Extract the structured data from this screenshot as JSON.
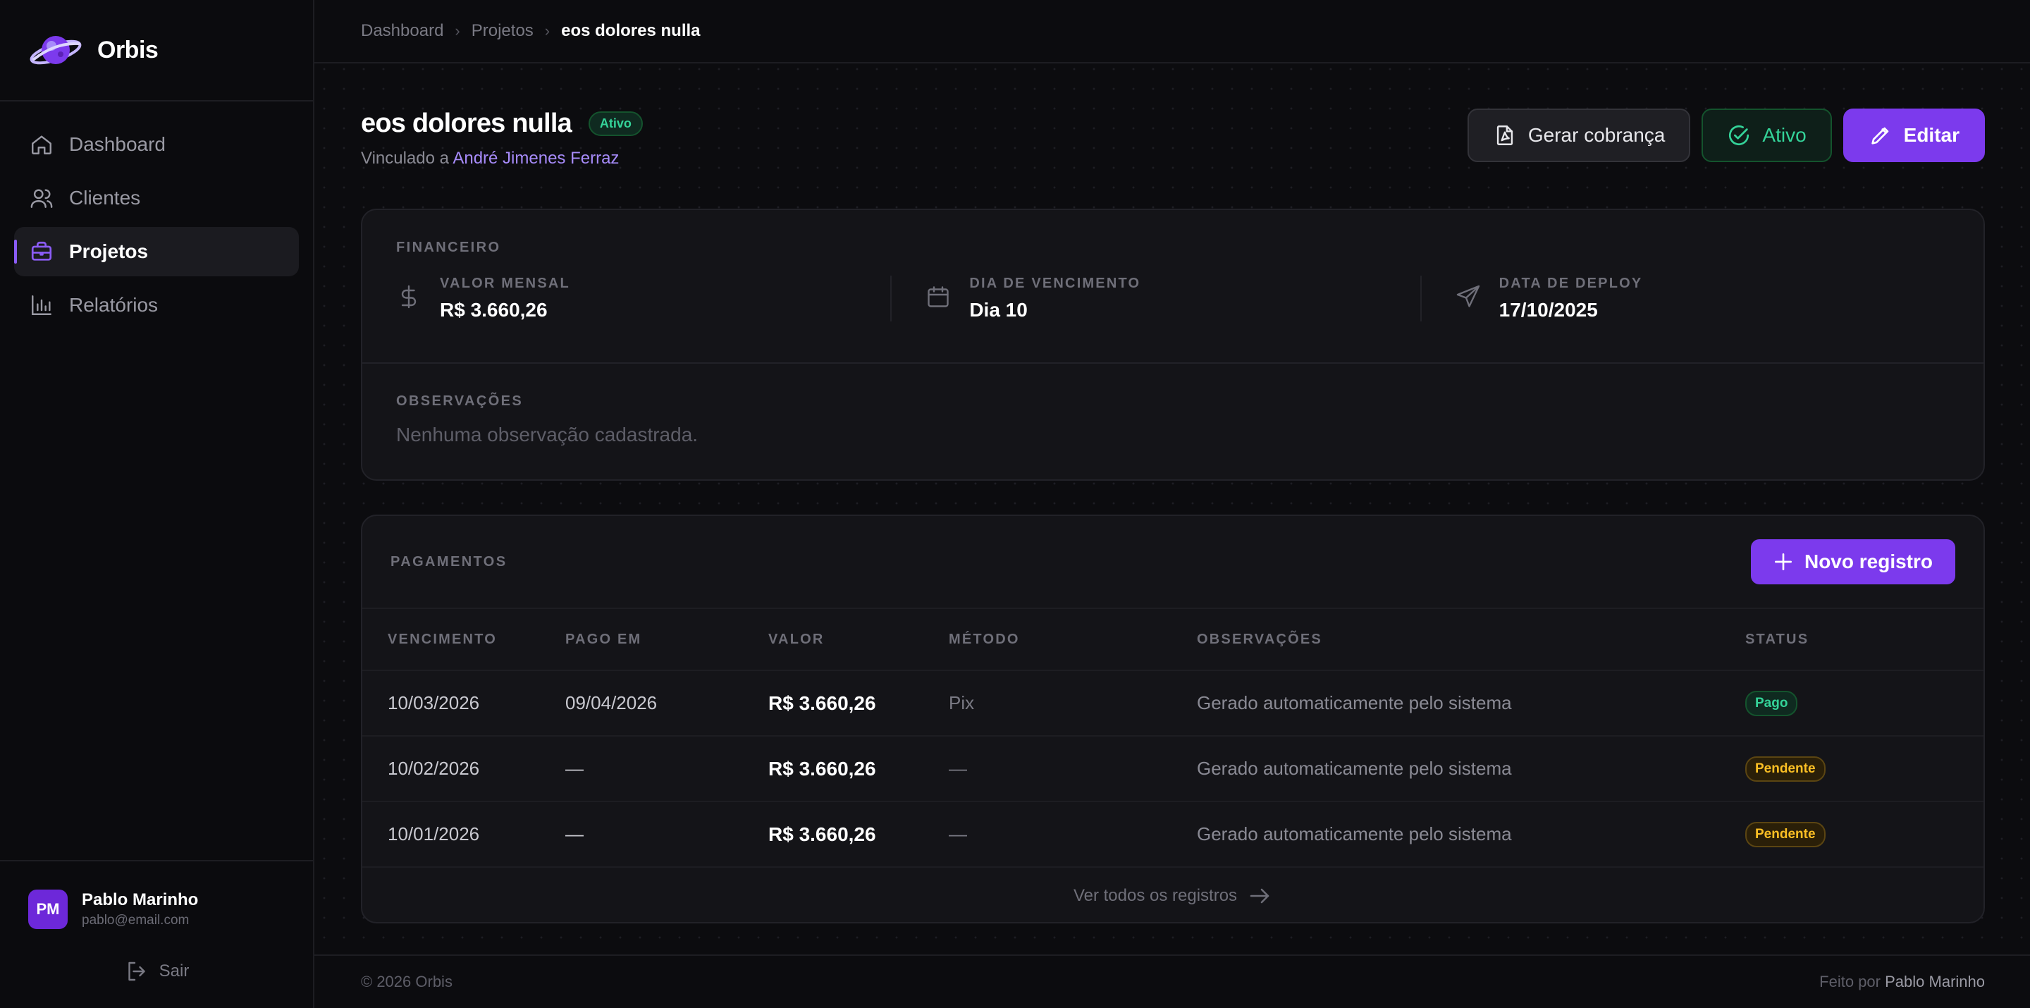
{
  "brand": {
    "name": "Orbis",
    "logo_icon": "planet-logo-icon"
  },
  "sidebar": {
    "items": [
      {
        "label": "Dashboard",
        "icon": "home-icon",
        "active": false
      },
      {
        "label": "Clientes",
        "icon": "users-icon",
        "active": false
      },
      {
        "label": "Projetos",
        "icon": "briefcase-icon",
        "active": true
      },
      {
        "label": "Relatórios",
        "icon": "bar-chart-icon",
        "active": false
      }
    ],
    "user": {
      "initials": "PM",
      "name": "Pablo Marinho",
      "email": "pablo@email.com"
    },
    "logout_label": "Sair"
  },
  "breadcrumb": {
    "items": [
      "Dashboard",
      "Projetos"
    ],
    "current": "eos dolores nulla"
  },
  "project": {
    "title": "eos dolores nulla",
    "status_badge": "Ativo",
    "linked_prefix": "Vinculado a",
    "linked_client": "André Jimenes Ferraz"
  },
  "actions": {
    "invoice_label": "Gerar cobrança",
    "status_label": "Ativo",
    "edit_label": "Editar"
  },
  "financeiro": {
    "section_label": "FINANCEIRO",
    "monthly_label": "VALOR MENSAL",
    "monthly_value": "R$ 3.660,26",
    "due_label": "DIA DE VENCIMENTO",
    "due_value": "Dia 10",
    "deploy_label": "DATA DE DEPLOY",
    "deploy_value": "17/10/2025",
    "notes_label": "OBSERVAÇÕES",
    "notes_value": "Nenhuma observação cadastrada."
  },
  "pagamentos": {
    "section_label": "PAGAMENTOS",
    "new_label": "Novo registro",
    "columns": [
      "VENCIMENTO",
      "PAGO EM",
      "VALOR",
      "MÉTODO",
      "OBSERVAÇÕES",
      "STATUS"
    ],
    "rows": [
      {
        "due": "10/03/2026",
        "paid": "09/04/2026",
        "value": "R$ 3.660,26",
        "method": "Pix",
        "notes": "Gerado automaticamente pelo sistema",
        "status": "Pago",
        "status_color": "#34d399"
      },
      {
        "due": "10/02/2026",
        "paid": "—",
        "value": "R$ 3.660,26",
        "method": "—",
        "notes": "Gerado automaticamente pelo sistema",
        "status": "Pendente",
        "status_color": "#fbbf24"
      },
      {
        "due": "10/01/2026",
        "paid": "—",
        "value": "R$ 3.660,26",
        "method": "—",
        "notes": "Gerado automaticamente pelo sistema",
        "status": "Pendente",
        "status_color": "#fbbf24"
      }
    ],
    "view_all_label": "Ver todos os registros"
  },
  "footer": {
    "copyright": "© 2026 Orbis",
    "made_by_prefix": "Feito por",
    "made_by_name": "Pablo Marinho"
  },
  "colors": {
    "accent": "#7c3aed",
    "success": "#34d399",
    "warning": "#fbbf24",
    "background": "#0c0c0f"
  }
}
